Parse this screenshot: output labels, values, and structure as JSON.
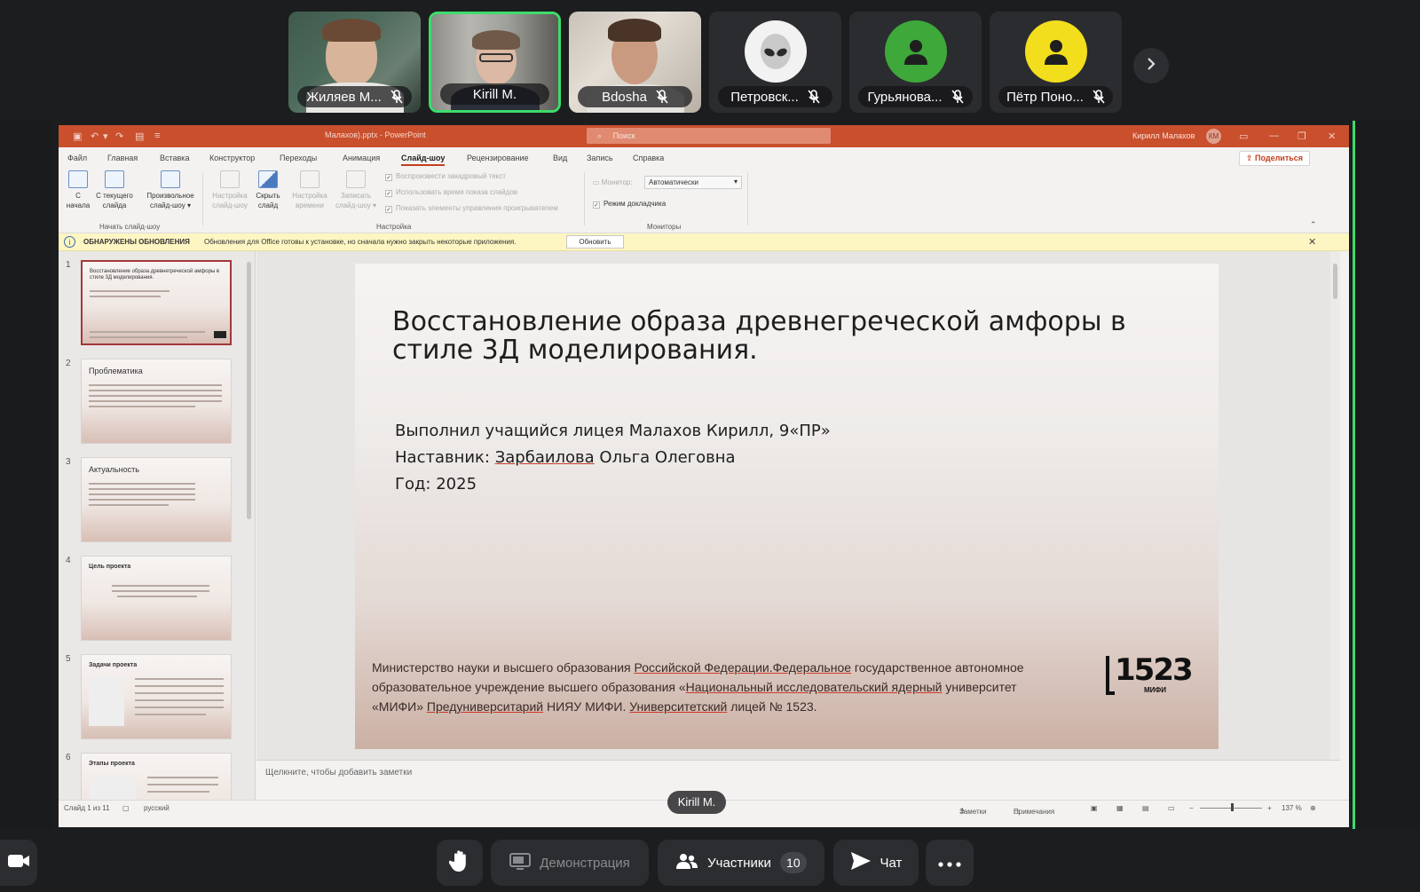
{
  "participants": [
    {
      "name": "Жиляев М...",
      "type": "video",
      "muted": true,
      "active": false
    },
    {
      "name": "Kirill M.",
      "type": "video",
      "muted": false,
      "active": true
    },
    {
      "name": "Bdosha",
      "type": "video",
      "muted": true,
      "active": false
    },
    {
      "name": "Петровск...",
      "type": "avatar",
      "avatar_icon": "alien-icon",
      "avatar_color": "#f2f2f2",
      "muted": true,
      "active": false
    },
    {
      "name": "Гурьянова...",
      "type": "avatar",
      "avatar_icon": "person-icon",
      "avatar_color": "#3ea83a",
      "muted": true,
      "active": false
    },
    {
      "name": "Пётр Поно...",
      "type": "avatar",
      "avatar_icon": "person-icon",
      "avatar_color": "#f2de1c",
      "muted": true,
      "active": false
    }
  ],
  "ppt": {
    "doc_title": "Малахов).pptx  -  PowerPoint",
    "search_placeholder": "Поиск",
    "user_name": "Кирилл Малахов",
    "user_initials": "КМ",
    "menu": [
      "Файл",
      "Главная",
      "Вставка",
      "Конструктор",
      "Переходы",
      "Анимация",
      "Слайд-шоу",
      "Рецензирование",
      "Вид",
      "Запись",
      "Справка"
    ],
    "active_menu": "Слайд-шоу",
    "share_label": "Поделиться",
    "ribbon": {
      "from_start": [
        "С",
        "начала"
      ],
      "from_current": [
        "С текущего",
        "слайда"
      ],
      "custom": [
        "Произвольное",
        "слайд-шоу ▾"
      ],
      "group_start": "Начать слайд-шоу",
      "setup": [
        "Настройка",
        "слайд-шоу"
      ],
      "hide": [
        "Скрыть",
        "слайд"
      ],
      "timing": [
        "Настройка",
        "времени"
      ],
      "record": [
        "Записать",
        "слайд-шоу ▾"
      ],
      "check_narration": "Воспроизвести закадровый текст",
      "check_timings": "Использовать время показа слайдов",
      "check_controls": "Показать элементы управления проигрывателем",
      "group_setup": "Настройка",
      "monitor_label": "Монитор:",
      "monitor_value": "Автоматически",
      "presenter_view": "Режим докладчика",
      "group_monitors": "Мониторы"
    },
    "update_bar": {
      "title": "ОБНАРУЖЕНЫ ОБНОВЛЕНИЯ",
      "text": "Обновления для Office готовы к установке, но сначала нужно закрыть некоторые приложения.",
      "button": "Обновить"
    },
    "thumbnails": [
      {
        "num": "1",
        "title": "Восстановление образа древнегреческой амфоры в стиле 3Д моделирования."
      },
      {
        "num": "2",
        "title": "Проблематика"
      },
      {
        "num": "3",
        "title": "Актуальность"
      },
      {
        "num": "4",
        "title": "Цель проекта"
      },
      {
        "num": "5",
        "title": "Задачи проекта"
      },
      {
        "num": "6",
        "title": "Этапы проекта"
      }
    ],
    "slide": {
      "title": "Восстановление образа древнегреческой амфоры в стиле 3Д моделирования.",
      "line1": "Выполнил учащийся лицея Малахов Кирилл, 9«ПР»",
      "line2_prefix": "Наставник: ",
      "line2_name": "Зарбаилова",
      "line2_rest": " Ольга Олеговна",
      "line3": "Год: 2025",
      "footer_l1a": "Министерство науки и высшего образования ",
      "footer_l1b": "Российской Федерации.Федеральное",
      "footer_l1c": " государственное автономное",
      "footer_l2a": "образовательное учреждение высшего образования «",
      "footer_l2b": "Национальный исследовательский ядерный",
      "footer_l2c": " университет",
      "footer_l3a": "«МИФИ» ",
      "footer_l3b": "Предуниверситарий",
      "footer_l3c": " НИЯУ МИФИ. ",
      "footer_l3d": "Университетский",
      "footer_l3e": " лицей № 1523.",
      "logo_num": "1523",
      "logo_sub": "МИФИ"
    },
    "notes_placeholder": "Щелкните, чтобы добавить заметки",
    "status": {
      "slide_info": "Слайд 1 из 11",
      "language": "русский",
      "notes": "Заметки",
      "comments": "Примечания",
      "zoom": "137 %"
    }
  },
  "speaker_label": "Kirill M.",
  "controls": {
    "demo_label": "Демонстрация",
    "participants_label": "Участники",
    "participants_count": "10",
    "chat_label": "Чат"
  }
}
